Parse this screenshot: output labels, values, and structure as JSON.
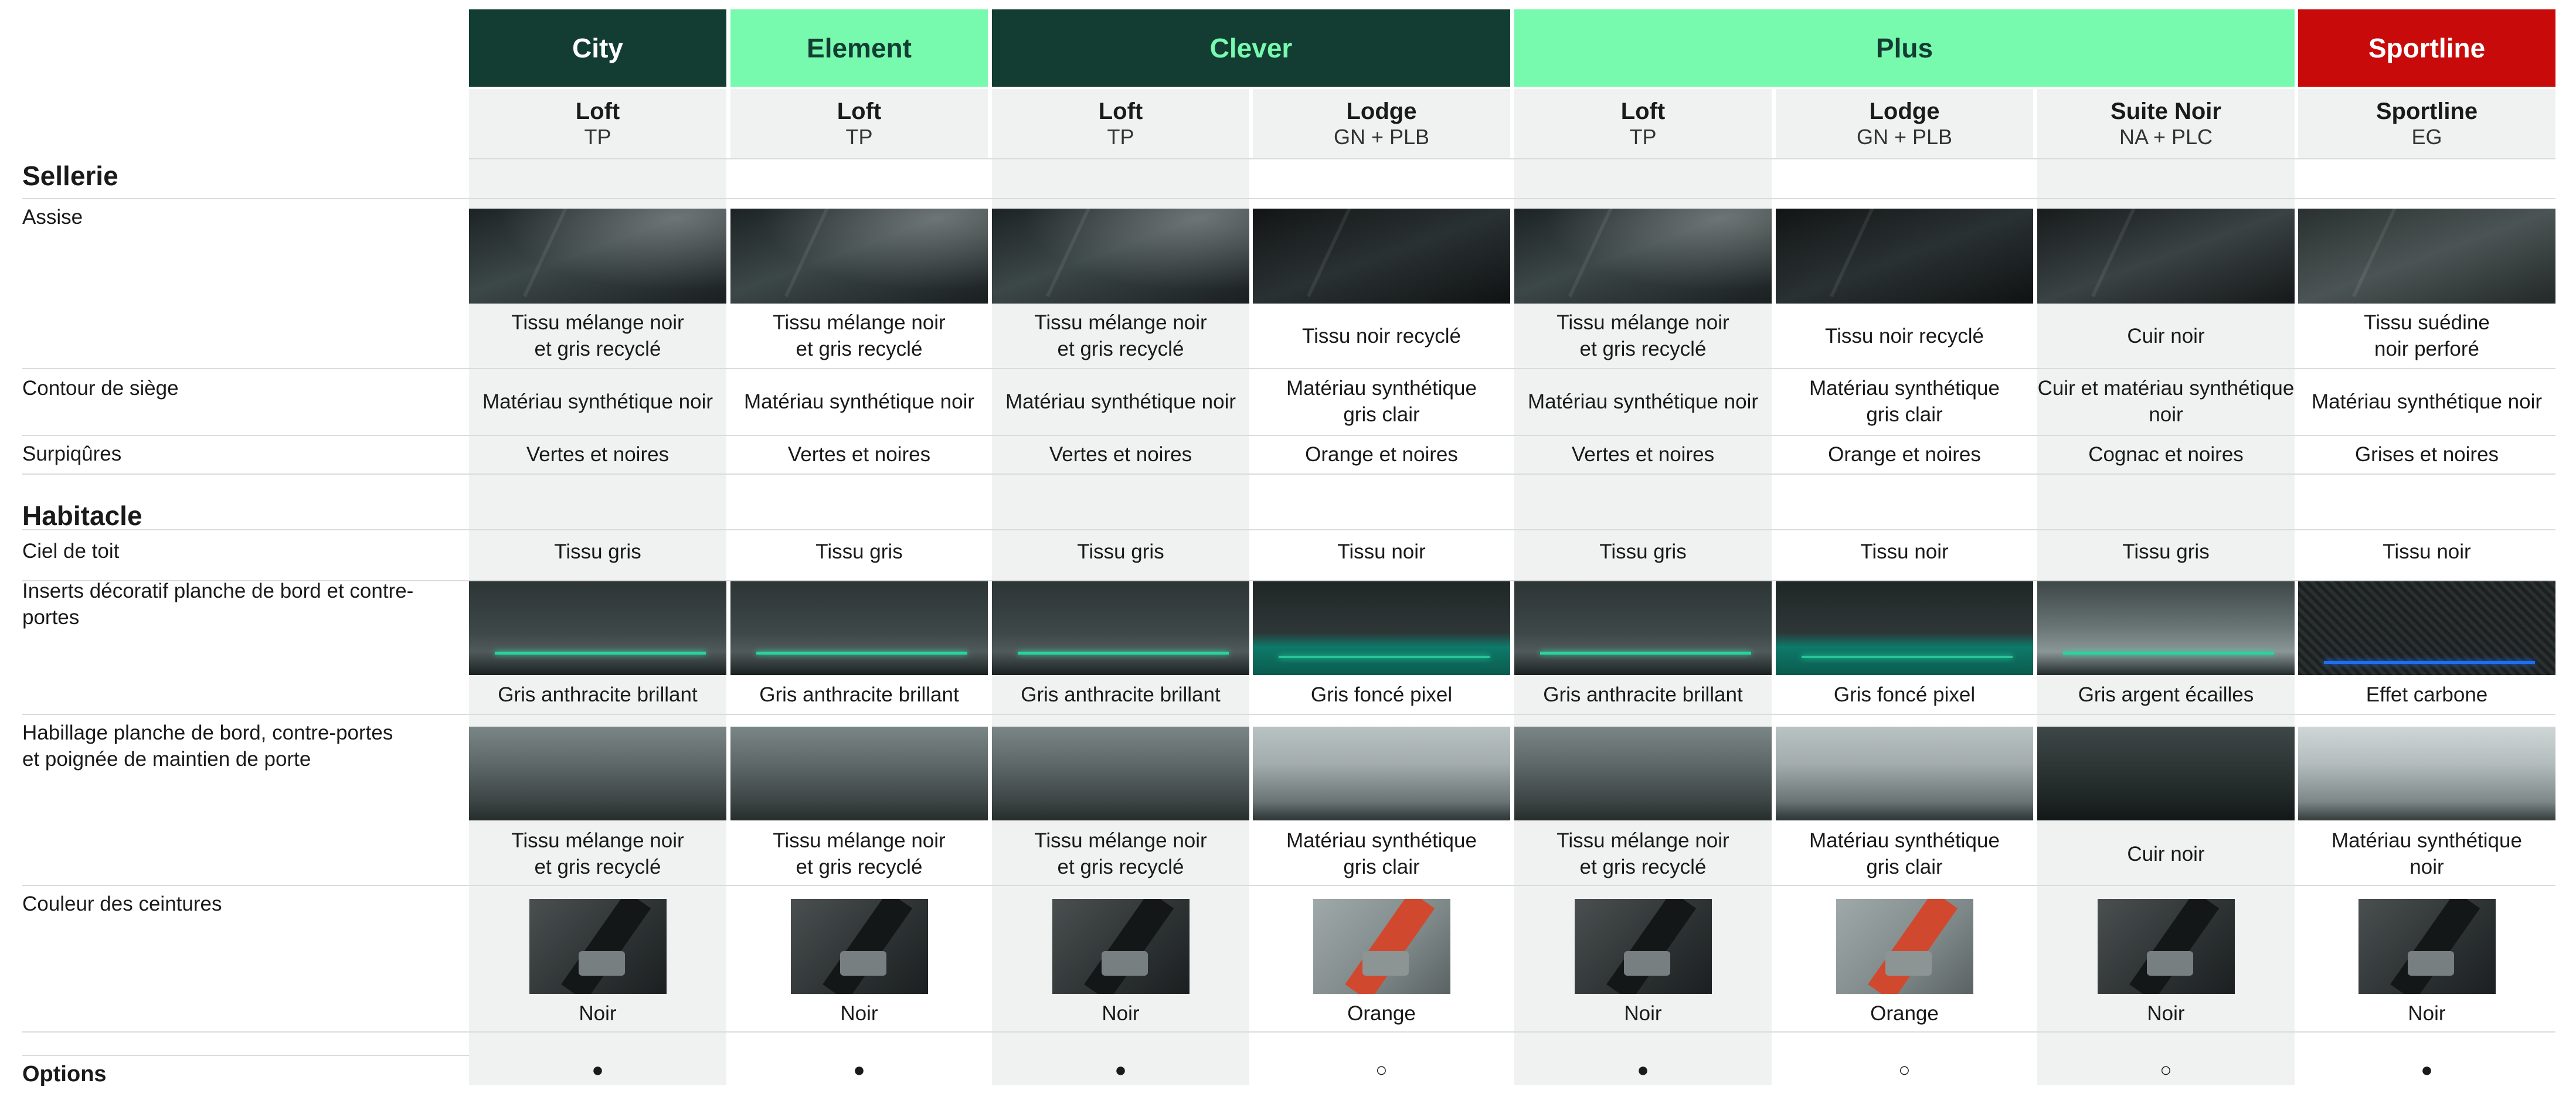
{
  "trims": [
    {
      "label": "City",
      "bg": "#133d33",
      "fg": "#ffffff"
    },
    {
      "label": "Element",
      "bg": "#78faae",
      "fg": "#133d33"
    },
    {
      "label": "Clever",
      "bg": "#133d33",
      "fg": "#78faae"
    },
    {
      "label": "Plus",
      "bg": "#78faae",
      "fg": "#133d33"
    },
    {
      "label": "Sportline",
      "bg": "#c80a0a",
      "fg": "#ffffff"
    }
  ],
  "interiors": [
    {
      "name": "Loft",
      "code": "TP"
    },
    {
      "name": "Loft",
      "code": "TP"
    },
    {
      "name": "Loft",
      "code": "TP"
    },
    {
      "name": "Lodge",
      "code": "GN + PLB"
    },
    {
      "name": "Loft",
      "code": "TP"
    },
    {
      "name": "Lodge",
      "code": "GN + PLB"
    },
    {
      "name": "Suite Noir",
      "code": "NA + PLC"
    },
    {
      "name": "Sportline",
      "code": "EG"
    }
  ],
  "sections": {
    "sellerie": "Sellerie",
    "habitacle": "Habitacle",
    "options": "Options"
  },
  "rows": {
    "assise": {
      "label": "Assise",
      "values": [
        "Tissu mélange noir\net gris recyclé",
        "Tissu mélange noir\net gris recyclé",
        "Tissu mélange noir\net gris recyclé",
        "Tissu noir recyclé",
        "Tissu mélange noir\net gris recyclé",
        "Tissu noir recyclé",
        "Cuir noir",
        "Tissu suédine\nnoir perforé"
      ]
    },
    "contour": {
      "label": "Contour de siège",
      "values": [
        "Matériau synthétique noir",
        "Matériau synthétique noir",
        "Matériau synthétique noir",
        "Matériau synthétique\ngris clair",
        "Matériau synthétique noir",
        "Matériau synthétique\ngris clair",
        "Cuir et matériau synthétique\nnoir",
        "Matériau synthétique noir"
      ]
    },
    "surpiqures": {
      "label": "Surpiqûres",
      "values": [
        "Vertes et noires",
        "Vertes et noires",
        "Vertes et noires",
        "Orange et noires",
        "Vertes et noires",
        "Orange et noires",
        "Cognac et noires",
        "Grises et noires"
      ]
    },
    "ciel": {
      "label": "Ciel de toit",
      "values": [
        "Tissu gris",
        "Tissu gris",
        "Tissu gris",
        "Tissu noir",
        "Tissu gris",
        "Tissu noir",
        "Tissu gris",
        "Tissu noir"
      ]
    },
    "inserts": {
      "label": "Inserts décoratif planche de bord et contre-\nportes",
      "values": [
        "Gris anthracite brillant",
        "Gris anthracite brillant",
        "Gris anthracite brillant",
        "Gris foncé pixel",
        "Gris anthracite brillant",
        "Gris foncé pixel",
        "Gris argent écailles",
        "Effet carbone"
      ]
    },
    "habillage": {
      "label": "Habillage planche de bord, contre-portes\net poignée de maintien de porte",
      "values": [
        "Tissu mélange noir\net gris recyclé",
        "Tissu mélange noir\net gris recyclé",
        "Tissu mélange noir\net gris recyclé",
        "Matériau synthétique\ngris clair",
        "Tissu mélange noir\net gris recyclé",
        "Matériau synthétique\ngris clair",
        "Cuir noir",
        "Matériau synthétique\nnoir"
      ]
    },
    "ceintures": {
      "label": "Couleur des ceintures",
      "values": [
        "Noir",
        "Noir",
        "Noir",
        "Orange",
        "Noir",
        "Orange",
        "Noir",
        "Noir"
      ]
    },
    "options": {
      "values": [
        "●",
        "●",
        "●",
        "○",
        "●",
        "○",
        "○",
        "●"
      ]
    }
  },
  "swatch_types": {
    "assise": [
      "seat",
      "seat",
      "seat",
      "seat black",
      "seat",
      "seat black",
      "seat leather",
      "seat suede"
    ],
    "inserts": [
      "insert",
      "insert",
      "insert",
      "insert pixel",
      "insert",
      "insert pixel",
      "insert silver",
      "insert carbon"
    ],
    "habillage": [
      "dash",
      "dash",
      "dash",
      "dash light",
      "dash",
      "dash light",
      "dash black",
      "dash pale"
    ],
    "ceintures": [
      "belt",
      "belt",
      "belt",
      "belt orange",
      "belt",
      "belt orange",
      "belt",
      "belt"
    ]
  }
}
